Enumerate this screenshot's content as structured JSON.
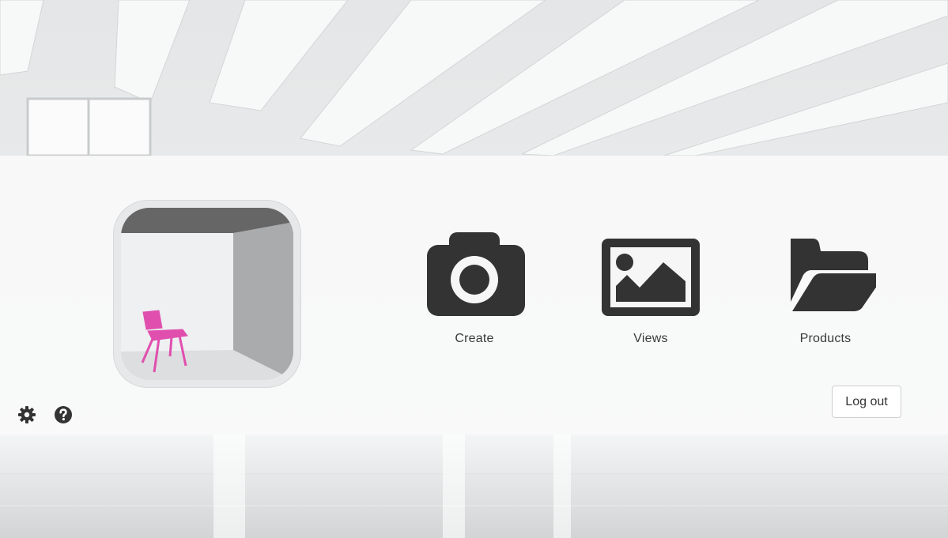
{
  "tiles": [
    {
      "label": "Create",
      "icon": "camera-icon"
    },
    {
      "label": "Views",
      "icon": "image-icon"
    },
    {
      "label": "Products",
      "icon": "folder-open-icon"
    }
  ],
  "logout_label": "Log out",
  "footer_icons": [
    "gear-icon",
    "help-icon"
  ],
  "colors": {
    "icon": "#333333",
    "chair": "#e04fae",
    "band": "#fafafa"
  }
}
